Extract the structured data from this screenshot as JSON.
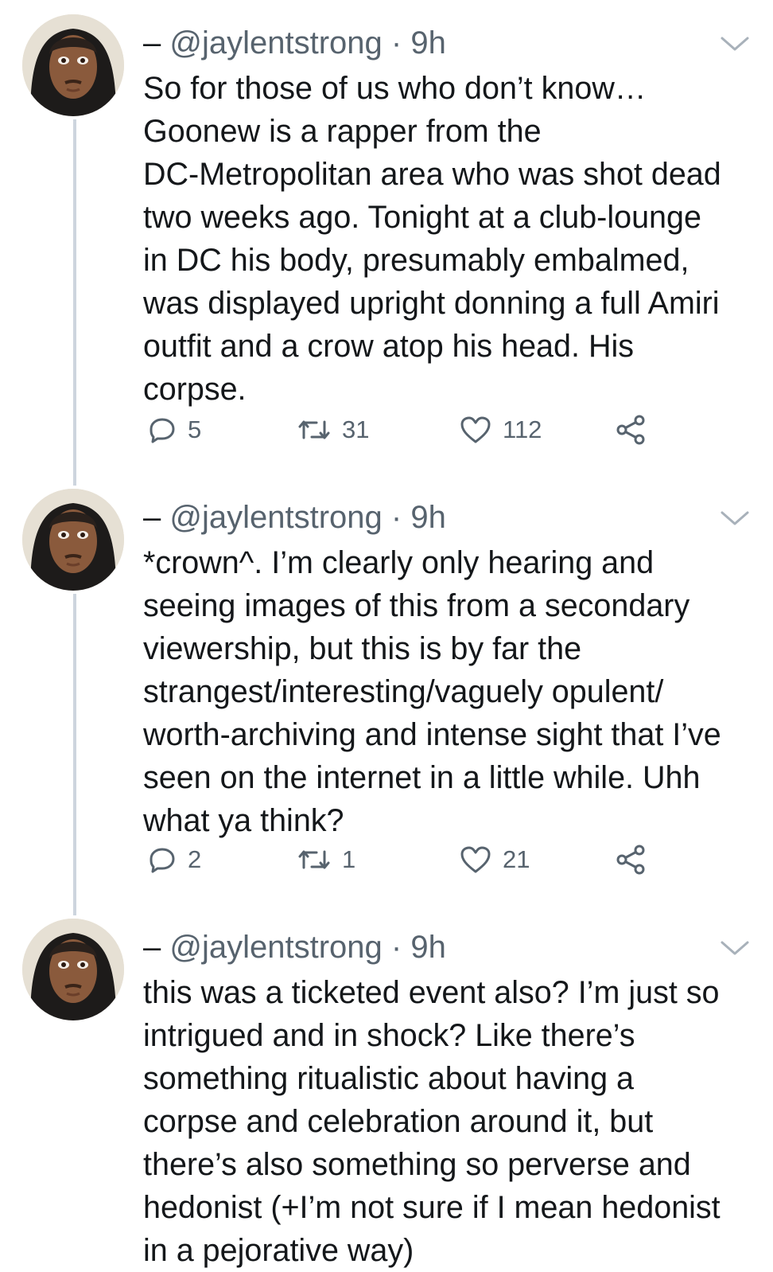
{
  "colors": {
    "text": "#14171a",
    "secondary": "#57636e",
    "thread_line": "#cdd5de",
    "background": "#ffffff"
  },
  "tweets": [
    {
      "dash": "–",
      "handle": "@jaylentstrong",
      "separator": "·",
      "time": "9h",
      "text": "So for those of us who don’t know…\nGoonew is a rapper from the\nDC-Metropolitan area who was shot dead\ntwo weeks ago. Tonight at a club-lounge\nin DC his body, presumably embalmed,\nwas displayed upright donning a full Amiri\noutfit and a crow atop his head. His\ncorpse.",
      "replies": "5",
      "retweets": "31",
      "likes": "112",
      "icons": [
        "reply-icon",
        "retweet-icon",
        "like-icon",
        "share-icon",
        "chevron-down-icon"
      ]
    },
    {
      "dash": "–",
      "handle": "@jaylentstrong",
      "separator": "·",
      "time": "9h",
      "text": "*crown^. I’m clearly only hearing and\nseeing images of this from a secondary\nviewership, but this is by far the\nstrangest/interesting/vaguely opulent/\nworth-archiving and intense sight that I’ve\nseen on the internet in a little while. Uhh\nwhat ya think?",
      "replies": "2",
      "retweets": "1",
      "likes": "21",
      "icons": [
        "reply-icon",
        "retweet-icon",
        "like-icon",
        "share-icon",
        "chevron-down-icon"
      ]
    },
    {
      "dash": "–",
      "handle": "@jaylentstrong",
      "separator": "·",
      "time": "9h",
      "text": "this was a ticketed event also? I’m just so\nintrigued and in shock? Like there’s\nsomething ritualistic about having a\ncorpse and celebration around it, but\nthere’s also something so perverse and\nhedonist (+I’m not sure if I mean hedonist\nin a pejorative way)",
      "icons": [
        "chevron-down-icon"
      ]
    }
  ]
}
